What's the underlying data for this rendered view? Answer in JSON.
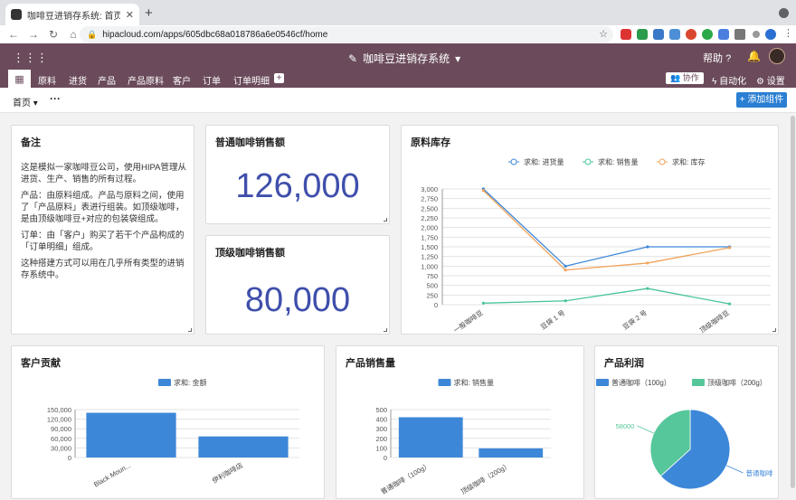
{
  "browser": {
    "tab_title": "咖啡豆进销存系统: 首页",
    "url": "hipacloud.com/apps/605dbc68a018786a6e0546cf/home"
  },
  "header": {
    "app_name": "咖啡豆进销存系统",
    "help": "帮助"
  },
  "menu": {
    "items": [
      "原料",
      "进货",
      "产品",
      "产品原料",
      "客户",
      "订单",
      "订单明细"
    ],
    "collab": "协作",
    "automation": "自动化",
    "settings": "设置"
  },
  "page": {
    "name": "首页",
    "add_widget": "添加组件"
  },
  "note": {
    "title": "备注",
    "paragraphs": [
      "这是模拟一家咖啡豆公司，使用HIPA管理从进货、生产、销售的所有过程。",
      "产品：由原料组成。产品与原料之间，使用了「产品原料」表进行组装。如顶级咖啡，是由顶级咖啡豆+对应的包装袋组成。",
      "订单：由「客户」购买了若干个产品构成的「订单明细」组成。",
      "这种搭建方式可以用在几乎所有类型的进销存系统中。"
    ]
  },
  "kpi1": {
    "title": "普通咖啡销售额",
    "value": "126,000"
  },
  "kpi2": {
    "title": "顶级咖啡销售额",
    "value": "80,000"
  },
  "cards": {
    "stock": "原料库存",
    "customer": "客户贡献",
    "sales": "产品销售量",
    "profit": "产品利润"
  },
  "chart_data": [
    {
      "type": "line",
      "categories": [
        "一般咖啡豆",
        "豆袋 1 号",
        "豆袋 2 号",
        "顶级咖啡豆"
      ],
      "series": [
        {
          "name": "求和: 进货量",
          "values": [
            3000,
            1000,
            1500,
            1500
          ],
          "color": "#3d87d8"
        },
        {
          "name": "求和: 销售量",
          "values": [
            40,
            100,
            420,
            20
          ],
          "color": "#48c49a"
        },
        {
          "name": "求和: 库存",
          "values": [
            2960,
            900,
            1080,
            1480
          ],
          "color": "#f0a35a"
        }
      ],
      "yticks": [
        0,
        250,
        500,
        750,
        1000,
        1250,
        1500,
        1750,
        2000,
        2250,
        2500,
        2750,
        3000
      ],
      "ytick_labels": [
        "0",
        "250",
        "500",
        "750",
        "1,000",
        "1,250",
        "1,500",
        "1,750",
        "2,000",
        "2,250",
        "2,500",
        "2,750",
        "3,000"
      ],
      "ylim": [
        0,
        3000
      ],
      "legend": "top"
    },
    {
      "type": "bar",
      "categories": [
        "Black Moun...",
        "伊利咖啡店"
      ],
      "series": [
        {
          "name": "求和: 金额",
          "values": [
            140000,
            66000
          ],
          "color": "#3d87d8"
        }
      ],
      "yticks": [
        0,
        30000,
        60000,
        90000,
        120000,
        150000
      ],
      "ytick_labels": [
        "0",
        "30,000",
        "60,000",
        "90,000",
        "120,000",
        "150,000"
      ],
      "ylim": [
        0,
        150000
      ],
      "legend": "top"
    },
    {
      "type": "bar",
      "categories": [
        "普通咖啡（100g）",
        "顶级咖啡（200g）"
      ],
      "series": [
        {
          "name": "求和: 销售量",
          "values": [
            420,
            95
          ],
          "color": "#3d87d8"
        }
      ],
      "yticks": [
        0,
        100,
        200,
        300,
        400,
        500
      ],
      "ytick_labels": [
        "0",
        "100",
        "200",
        "300",
        "400",
        "500"
      ],
      "ylim": [
        0,
        500
      ],
      "legend": "top"
    },
    {
      "type": "pie",
      "labels": [
        "普通咖啡（100g）",
        "顶级咖啡（200g）"
      ],
      "values": [
        100000,
        58000
      ],
      "data_labels": [
        "普通咖啡",
        "58000"
      ],
      "colors": [
        "#3d87d8",
        "#56c79a"
      ],
      "legend": "top"
    }
  ]
}
